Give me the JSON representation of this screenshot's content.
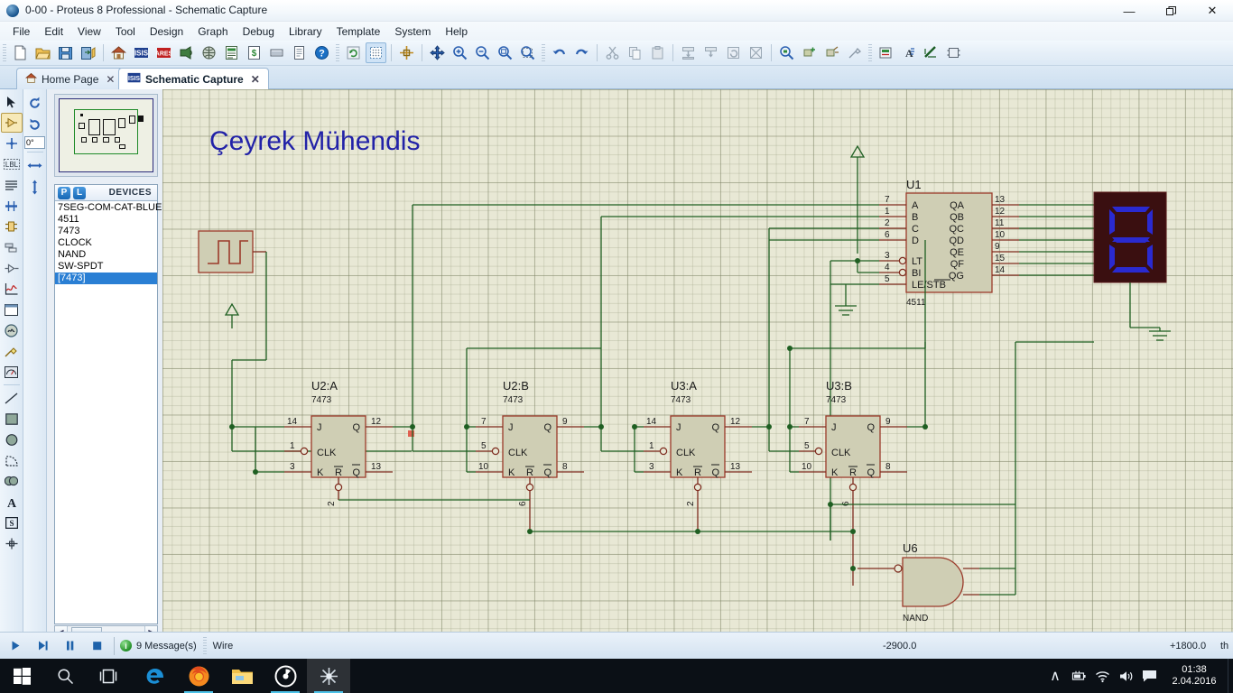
{
  "window": {
    "title": "0-00 - Proteus 8 Professional - Schematic Capture",
    "app_icon": "proteus-icon",
    "minimize": "—",
    "maximize": "❐",
    "close": "✕"
  },
  "menubar": {
    "items": [
      {
        "label": "File"
      },
      {
        "label": "Edit"
      },
      {
        "label": "View"
      },
      {
        "label": "Tool"
      },
      {
        "label": "Design"
      },
      {
        "label": "Graph"
      },
      {
        "label": "Debug"
      },
      {
        "label": "Library"
      },
      {
        "label": "Template"
      },
      {
        "label": "System"
      },
      {
        "label": "Help"
      }
    ]
  },
  "toolbar": {
    "groups": [
      {
        "buttons": [
          {
            "name": "new-file-icon",
            "title": "New Project"
          },
          {
            "name": "open-file-icon",
            "title": "Open Project"
          },
          {
            "name": "save-icon",
            "title": "Save Project"
          },
          {
            "name": "import-icon",
            "title": "Import/Export"
          }
        ]
      },
      {
        "buttons": [
          {
            "name": "home-icon",
            "title": "Home Page"
          },
          {
            "name": "isis-icon",
            "title": "Schematic Capture"
          },
          {
            "name": "ares-icon",
            "title": "PCB Layout"
          },
          {
            "name": "3d-view-icon",
            "title": "3D Visualizer"
          },
          {
            "name": "design-explorer-icon",
            "title": "Design Explorer"
          },
          {
            "name": "bom-icon",
            "title": "Bill of Materials"
          },
          {
            "name": "cost-icon",
            "title": "Project Costing"
          },
          {
            "name": "notes-icon",
            "title": "Project Notes"
          },
          {
            "name": "report-icon",
            "title": "Reports"
          },
          {
            "name": "help-icon",
            "title": "Help"
          }
        ]
      },
      {
        "buttons": [
          {
            "name": "refresh-icon",
            "title": "Redraw Display"
          },
          {
            "name": "grid-toggle-icon",
            "title": "Toggle Grid"
          },
          {
            "name": "origin-icon",
            "title": "Set Origin"
          },
          {
            "name": "pan-icon",
            "title": "Pan"
          },
          {
            "name": "zoom-in-icon",
            "title": "Zoom In"
          },
          {
            "name": "zoom-out-icon",
            "title": "Zoom Out"
          },
          {
            "name": "zoom-all-icon",
            "title": "Zoom To View Entire Sheet"
          },
          {
            "name": "zoom-area-icon",
            "title": "Zoom To Area"
          }
        ]
      },
      {
        "buttons": [
          {
            "name": "undo-icon",
            "title": "Undo"
          },
          {
            "name": "redo-icon",
            "title": "Redo"
          },
          {
            "name": "cut-icon",
            "title": "Cut"
          },
          {
            "name": "copy-icon",
            "title": "Copy"
          },
          {
            "name": "paste-icon",
            "title": "Paste"
          },
          {
            "name": "block-copy-icon",
            "title": "Block Copy"
          },
          {
            "name": "block-move-icon",
            "title": "Block Move"
          },
          {
            "name": "block-rotate-icon",
            "title": "Block Rotate"
          },
          {
            "name": "block-delete-icon",
            "title": "Block Delete"
          },
          {
            "name": "pick-device-icon",
            "title": "Pick Device"
          },
          {
            "name": "make-device-icon",
            "title": "Make Device"
          },
          {
            "name": "packaging-icon",
            "title": "Packaging Tool"
          },
          {
            "name": "decompose-icon",
            "title": "Decompose"
          }
        ]
      },
      {
        "buttons": [
          {
            "name": "wire-label-icon",
            "title": "Wire Label"
          },
          {
            "name": "text-script-icon",
            "title": "Text Script"
          },
          {
            "name": "bus-icon",
            "title": "Buses"
          },
          {
            "name": "subcircuit-icon",
            "title": "Subcircuit"
          }
        ]
      }
    ]
  },
  "tabs": [
    {
      "label": "Home Page",
      "icon": "home-icon",
      "active": false,
      "close": "✕"
    },
    {
      "label": "Schematic Capture",
      "icon": "isis-icon",
      "active": true,
      "close": "✕"
    }
  ],
  "left_tools": [
    {
      "name": "selection-mode-tool",
      "title": "Selection Mode",
      "selected": false
    },
    {
      "name": "component-mode-tool",
      "title": "Component Mode",
      "selected": true
    },
    {
      "name": "junction-dot-tool",
      "title": "Junction Dot Mode",
      "selected": false
    },
    {
      "name": "wire-label-tool",
      "title": "Wire Label Mode",
      "selected": false,
      "label": "LBL"
    },
    {
      "name": "text-script-tool",
      "title": "Text Script Mode",
      "selected": false
    },
    {
      "name": "bus-tool",
      "title": "Buses Mode",
      "selected": false
    },
    {
      "name": "subcircuit-tool",
      "title": "Subcircuit Mode",
      "selected": false
    },
    {
      "name": "terminals-tool",
      "title": "Terminals Mode",
      "selected": false
    },
    {
      "name": "device-pin-tool",
      "title": "Device Pins Mode",
      "selected": false
    },
    {
      "name": "graph-tool",
      "title": "Graph Mode",
      "selected": false
    },
    {
      "name": "tape-recorder-tool",
      "title": "Tape Recorder Mode",
      "selected": false
    },
    {
      "name": "generator-tool",
      "title": "Generator Mode",
      "selected": false
    },
    {
      "name": "probe-tool",
      "title": "Voltage Probe Mode",
      "selected": false
    },
    {
      "name": "virtual-instrument-tool",
      "title": "Virtual Instruments Mode",
      "selected": false
    },
    {
      "name": "line-tool",
      "title": "2D Graphics Line",
      "selected": false
    },
    {
      "name": "box-tool",
      "title": "2D Graphics Box",
      "selected": false
    },
    {
      "name": "circle-tool",
      "title": "2D Graphics Circle",
      "selected": false
    },
    {
      "name": "arc-tool",
      "title": "2D Graphics Arc",
      "selected": false
    },
    {
      "name": "path-tool",
      "title": "2D Graphics Path",
      "selected": false
    },
    {
      "name": "text-tool",
      "title": "2D Graphics Text",
      "selected": false
    },
    {
      "name": "symbol-tool",
      "title": "2D Graphics Symbol",
      "selected": false
    },
    {
      "name": "marker-tool",
      "title": "2D Graphics Markers",
      "selected": false
    }
  ],
  "rotation": {
    "rotate_cw_icon": "rotate-clockwise-icon",
    "rotate_ccw_icon": "rotate-counterclockwise-icon",
    "angle_value": "0°",
    "mirror_x_icon": "mirror-horizontal-icon",
    "mirror_y_icon": "mirror-vertical-icon"
  },
  "devices_panel": {
    "p_badge": "P",
    "l_badge": "L",
    "header": "DEVICES",
    "items": [
      {
        "label": "7SEG-COM-CAT-BLUE",
        "selected": false
      },
      {
        "label": "4511",
        "selected": false
      },
      {
        "label": "7473",
        "selected": false
      },
      {
        "label": "CLOCK",
        "selected": false
      },
      {
        "label": "NAND",
        "selected": false
      },
      {
        "label": "SW-SPDT",
        "selected": false
      },
      {
        "label": "[7473]",
        "selected": true
      }
    ],
    "scroll_left": "◀",
    "scroll_right": "▶"
  },
  "schematic": {
    "sheet_title": "Çeyrek Mühendis",
    "title_color": "#2222a8",
    "colors": {
      "body_fill": "#cfceb4",
      "body_stroke": "#9b3a2a",
      "pin_wire": "#7e2b1e",
      "net_wire": "#1f5f22",
      "text": "#1a1a1a",
      "display_bg": "#3a0f10",
      "display_seg_on": "#2a2ad0"
    },
    "components": [
      {
        "ref": "U1",
        "value": "4511",
        "type": "bcd-to-7segment-decoder",
        "inputs": [
          {
            "pin": "7",
            "label": "A"
          },
          {
            "pin": "1",
            "label": "B"
          },
          {
            "pin": "2",
            "label": "C"
          },
          {
            "pin": "6",
            "label": "D"
          },
          {
            "pin": "3",
            "label": "LT",
            "inverted": true
          },
          {
            "pin": "4",
            "label": "BI",
            "inverted": true
          },
          {
            "pin": "5",
            "label": "LE/STB",
            "overbar": "STB"
          }
        ],
        "outputs": [
          {
            "pin": "13",
            "label": "QA"
          },
          {
            "pin": "12",
            "label": "QB"
          },
          {
            "pin": "11",
            "label": "QC"
          },
          {
            "pin": "10",
            "label": "QD"
          },
          {
            "pin": "9",
            "label": "QE"
          },
          {
            "pin": "15",
            "label": "QF"
          },
          {
            "pin": "14",
            "label": "QG"
          }
        ]
      },
      {
        "ref": "U2:A",
        "value": "7473",
        "type": "jk-flip-flop",
        "inputs": [
          {
            "pin": "14",
            "label": "J"
          },
          {
            "pin": "1",
            "label": "CLK",
            "inverted": true
          },
          {
            "pin": "3",
            "label": "K"
          },
          {
            "pin": "2",
            "label": "R",
            "inverted": true
          }
        ],
        "outputs": [
          {
            "pin": "12",
            "label": "Q"
          },
          {
            "pin": "13",
            "label": "Q",
            "overbar": true
          }
        ]
      },
      {
        "ref": "U2:B",
        "value": "7473",
        "type": "jk-flip-flop",
        "inputs": [
          {
            "pin": "7",
            "label": "J"
          },
          {
            "pin": "5",
            "label": "CLK",
            "inverted": true
          },
          {
            "pin": "10",
            "label": "K"
          },
          {
            "pin": "6",
            "label": "R",
            "inverted": true
          }
        ],
        "outputs": [
          {
            "pin": "9",
            "label": "Q"
          },
          {
            "pin": "8",
            "label": "Q",
            "overbar": true
          }
        ]
      },
      {
        "ref": "U3:A",
        "value": "7473",
        "type": "jk-flip-flop",
        "inputs": [
          {
            "pin": "14",
            "label": "J"
          },
          {
            "pin": "1",
            "label": "CLK",
            "inverted": true
          },
          {
            "pin": "3",
            "label": "K"
          },
          {
            "pin": "2",
            "label": "R",
            "inverted": true
          }
        ],
        "outputs": [
          {
            "pin": "12",
            "label": "Q"
          },
          {
            "pin": "13",
            "label": "Q",
            "overbar": true
          }
        ]
      },
      {
        "ref": "U3:B",
        "value": "7473",
        "type": "jk-flip-flop",
        "inputs": [
          {
            "pin": "7",
            "label": "J"
          },
          {
            "pin": "5",
            "label": "CLK",
            "inverted": true
          },
          {
            "pin": "10",
            "label": "K"
          },
          {
            "pin": "6",
            "label": "R",
            "inverted": true
          }
        ],
        "outputs": [
          {
            "pin": "9",
            "label": "Q"
          },
          {
            "pin": "8",
            "label": "Q",
            "overbar": true
          }
        ]
      },
      {
        "ref": "U6",
        "value": "NAND",
        "type": "nand-gate"
      },
      {
        "ref": "",
        "value": "",
        "type": "clock-generator"
      },
      {
        "ref": "",
        "value": "",
        "type": "seven-segment-display",
        "digit": "8"
      }
    ]
  },
  "statusbar": {
    "transport": [
      {
        "name": "play-button",
        "glyph": "▶"
      },
      {
        "name": "step-button",
        "glyph": "▶❘"
      },
      {
        "name": "pause-button",
        "glyph": "❙❙"
      },
      {
        "name": "stop-button",
        "glyph": "■"
      }
    ],
    "message_icon": "info-icon",
    "message_text": "9 Message(s)",
    "mode_text": "Wire",
    "coord_x": "-2900.0",
    "coord_y": "+1800.0",
    "coord_units": "th"
  },
  "taskbar": {
    "items": [
      {
        "name": "start-button",
        "icon": "windows-logo-icon",
        "running": false,
        "active": false
      },
      {
        "name": "search-button",
        "icon": "search-icon",
        "running": false,
        "active": false
      },
      {
        "name": "task-view-button",
        "icon": "task-view-icon",
        "running": false,
        "active": false
      },
      {
        "name": "edge-button",
        "icon": "edge-icon",
        "running": false,
        "active": false
      },
      {
        "name": "firefox-button",
        "icon": "firefox-icon",
        "running": true,
        "active": false
      },
      {
        "name": "file-explorer-button",
        "icon": "folder-icon",
        "running": false,
        "active": false
      },
      {
        "name": "media-player-button",
        "icon": "disc-icon",
        "running": true,
        "active": false
      },
      {
        "name": "proteus-button",
        "icon": "proteus-icon",
        "running": true,
        "active": true
      }
    ],
    "tray": {
      "show_hidden": "∧",
      "icons": [
        {
          "name": "battery-icon"
        },
        {
          "name": "wifi-icon"
        },
        {
          "name": "volume-icon"
        },
        {
          "name": "action-center-icon"
        }
      ],
      "time": "01:38",
      "date": "2.04.2016"
    }
  }
}
